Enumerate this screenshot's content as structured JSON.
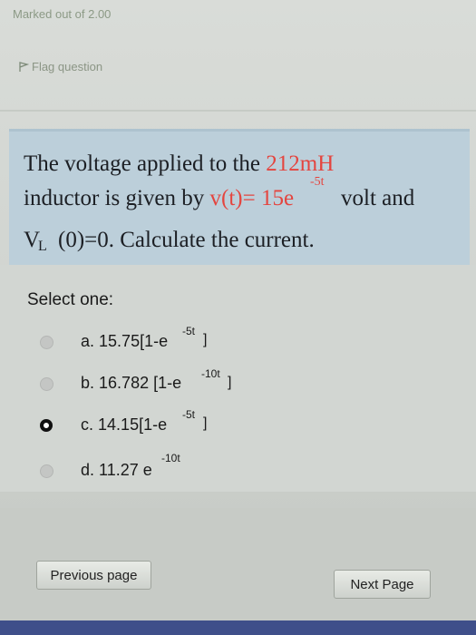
{
  "info": {
    "marked": "Marked out of 2.00",
    "flag_label": "Flag question"
  },
  "question": {
    "line1_pre": "The voltage applied to the ",
    "line1_red": "212mH",
    "line2_pre": "inductor is given by ",
    "line2_red": "v(t)= 15e",
    "line2_exp": "-5t",
    "line2_post": "volt and",
    "line3_v": "V",
    "line3_sub": "L",
    "line3_post": "(0)=0. Calculate the current."
  },
  "answer": {
    "select_one": "Select one:",
    "options": [
      {
        "letter": "a.",
        "text": "15.75[1-e",
        "exp": "-5t",
        "close": "]",
        "selected": false
      },
      {
        "letter": "b.",
        "text": "16.782 [1-e",
        "exp": "-10t",
        "close": "]",
        "selected": false
      },
      {
        "letter": "c.",
        "text": "14.15[1-e",
        "exp": "-5t",
        "close": "]",
        "selected": true
      },
      {
        "letter": "d.",
        "text": "11.27 e",
        "exp": "-10t",
        "close": "",
        "selected": false
      }
    ]
  },
  "nav": {
    "prev_label": "Previous page",
    "next_label": "Next Page"
  },
  "colors": {
    "accent_red": "#e4453f",
    "question_bg": "#bccfda"
  },
  "icons": {
    "flag": "flag-icon"
  }
}
